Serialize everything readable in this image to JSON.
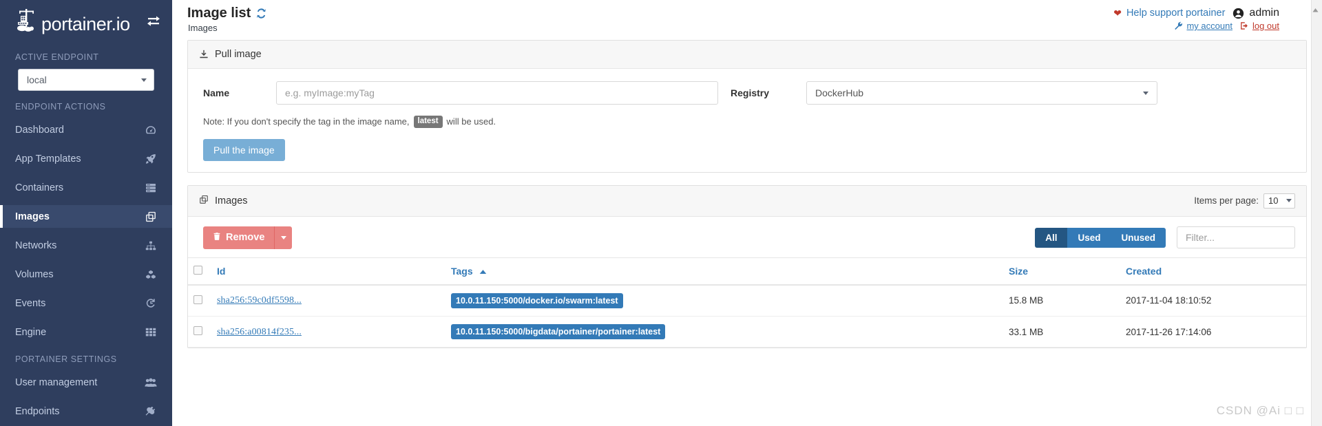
{
  "brand": {
    "name": "portainer.io",
    "toggle_icon": "exchange-icon"
  },
  "sidebar": {
    "sections": [
      {
        "title": "ACTIVE ENDPOINT"
      },
      {
        "title": "ENDPOINT ACTIONS"
      },
      {
        "title": "PORTAINER SETTINGS"
      }
    ],
    "endpoint_select": {
      "value": "local"
    },
    "endpoint_actions": [
      {
        "label": "Dashboard",
        "icon": "tachometer-icon",
        "active": false
      },
      {
        "label": "App Templates",
        "icon": "rocket-icon",
        "active": false
      },
      {
        "label": "Containers",
        "icon": "server-icon",
        "active": false
      },
      {
        "label": "Images",
        "icon": "clone-icon",
        "active": true
      },
      {
        "label": "Networks",
        "icon": "sitemap-icon",
        "active": false
      },
      {
        "label": "Volumes",
        "icon": "cubes-icon",
        "active": false
      },
      {
        "label": "Events",
        "icon": "history-icon",
        "active": false
      },
      {
        "label": "Engine",
        "icon": "th-grid-icon",
        "active": false
      }
    ],
    "portainer_settings": [
      {
        "label": "User management",
        "icon": "users-icon",
        "active": false
      },
      {
        "label": "Endpoints",
        "icon": "plug-icon",
        "active": false
      }
    ]
  },
  "header": {
    "title": "Image list",
    "refresh_icon": "refresh-icon",
    "breadcrumb": "Images",
    "heart_icon": "heart-icon",
    "help_label": "Help support portainer",
    "user_icon": "user-circle-icon",
    "user_name": "admin",
    "wrench_icon": "wrench-icon",
    "my_account_label": "my account",
    "logout_icon": "sign-out-icon",
    "logout_label": "log out"
  },
  "pull_panel": {
    "icon": "download-icon",
    "title": "Pull image",
    "name_label": "Name",
    "name_value": "",
    "name_placeholder": "e.g. myImage:myTag",
    "registry_label": "Registry",
    "registry_value": "DockerHub",
    "note_prefix": "Note: If you don't specify the tag in the image name,",
    "note_tag": "latest",
    "note_suffix": "will be used.",
    "pull_button": "Pull the image"
  },
  "images_panel": {
    "icon": "clone-icon",
    "title": "Images",
    "items_per_page_label": "Items per page:",
    "items_per_page_value": "10",
    "remove_icon": "trash-icon",
    "remove_label": "Remove",
    "filters": [
      {
        "label": "All",
        "selected": true
      },
      {
        "label": "Used",
        "selected": false
      },
      {
        "label": "Unused",
        "selected": false
      }
    ],
    "filter_placeholder": "Filter...",
    "filter_value": "",
    "columns": [
      "Id",
      "Tags",
      "Size",
      "Created"
    ],
    "sorted_column": "Tags",
    "sort_direction": "asc",
    "rows": [
      {
        "id": "sha256:59c0df5598...",
        "tag": "10.0.11.150:5000/docker.io/swarm:latest",
        "size": "15.8 MB",
        "created": "2017-11-04 18:10:52"
      },
      {
        "id": "sha256:a00814f235...",
        "tag": "10.0.11.150:5000/bigdata/portainer/portainer:latest",
        "size": "33.1 MB",
        "created": "2017-11-26 17:14:06"
      }
    ]
  },
  "watermark": {
    "text": "CSDN @Ai □ □"
  },
  "colors": {
    "sidebar_bg": "#2f3e5e",
    "accent_blue": "#337ab7",
    "danger_red": "#e98381",
    "pull_button_blue": "#78aed6"
  }
}
